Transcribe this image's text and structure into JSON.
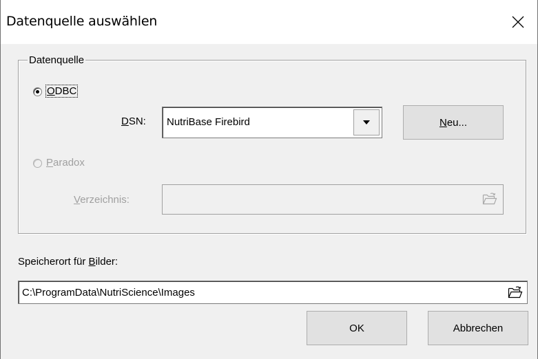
{
  "window": {
    "title": "Datenquelle auswählen",
    "close_glyph": "✕"
  },
  "datasource_group": {
    "legend": "Datenquelle",
    "odbc": {
      "label_accel": "O",
      "label_rest": "DBC",
      "selected": true
    },
    "dsn": {
      "label_accel": "D",
      "label_rest": "SN:",
      "value": "NutriBase Firebird"
    },
    "new_button": {
      "label_accel": "N",
      "label_rest": "eu..."
    },
    "paradox": {
      "label_accel": "P",
      "label_rest": "aradox",
      "selected": false,
      "enabled": false
    },
    "directory": {
      "label_accel": "V",
      "label_rest": "erzeichnis:",
      "value": "",
      "enabled": false
    }
  },
  "images_location": {
    "label_pre": "Speicherort für ",
    "label_accel": "B",
    "label_rest": "ilder:",
    "value": "C:\\ProgramData\\NutriScience\\Images"
  },
  "buttons": {
    "ok": "OK",
    "cancel": "Abbrechen"
  },
  "icons": {
    "close": "close-icon",
    "dropdown": "chevron-down-icon",
    "folder": "folder-open-icon"
  }
}
